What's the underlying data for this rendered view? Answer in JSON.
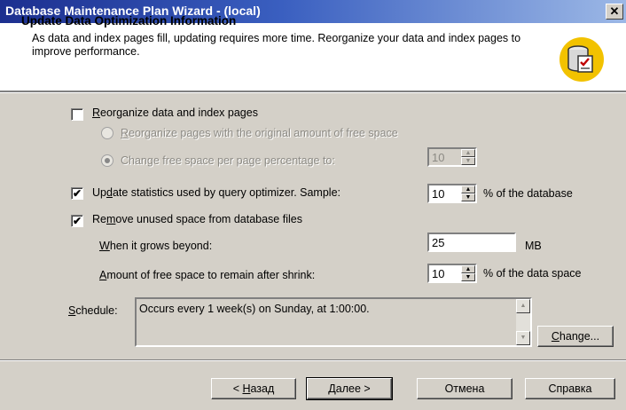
{
  "window": {
    "title": "Database Maintenance Plan Wizard - (local)",
    "close_glyph": "✕"
  },
  "header": {
    "title": "Update Data Optimization Information",
    "description": "As data and index pages fill, updating requires more time. Reorganize your data and index pages to improve performance."
  },
  "options": {
    "reorganize": {
      "label_u": "R",
      "label_rest": "eorganize data and index pages",
      "checked": false
    },
    "radio_original": {
      "label_u": "R",
      "label_rest": "eorganize pages with the original amount of free space",
      "selected": false
    },
    "radio_change": {
      "label": "Change free space per page percentage to:",
      "selected": true,
      "value": "10"
    },
    "update_stats": {
      "label_pre": "Up",
      "label_u": "d",
      "label_rest": "ate statistics used by query optimizer. Sample:",
      "checked": true,
      "value": "10",
      "suffix": "% of the database"
    },
    "remove_space": {
      "label_pre": "Re",
      "label_u": "m",
      "label_rest": "ove unused space from database files",
      "checked": true
    },
    "grows_beyond": {
      "label_u": "W",
      "label_rest": "hen it grows beyond:",
      "value": "25",
      "unit": "MB"
    },
    "free_space": {
      "label_u": "A",
      "label_rest": "mount of free space to remain after shrink:",
      "value": "10",
      "suffix": "% of the data space"
    }
  },
  "schedule": {
    "label_u": "S",
    "label_rest": "chedule:",
    "text": "Occurs every 1 week(s) on Sunday, at 1:00:00.",
    "change_u": "C",
    "change_rest": "hange..."
  },
  "footer": {
    "back_pre": "< ",
    "back_u": "Н",
    "back_rest": "азад",
    "next_u": "Д",
    "next_rest": "алее >",
    "cancel": "Отмена",
    "help": "Справка"
  },
  "icons": {
    "checkmark": "✔",
    "spin_up": "▲",
    "spin_down": "▼"
  },
  "colors": {
    "title_bar": "#1c2f8f",
    "dialog_bg": "#d4d0c8",
    "icon_circle": "#f2c200"
  }
}
